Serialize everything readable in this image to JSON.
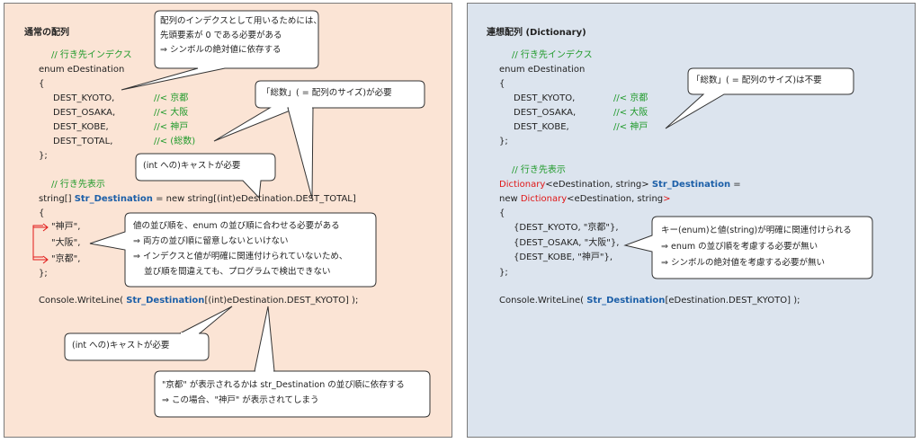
{
  "left": {
    "title": "通常の配列",
    "code": {
      "c1": "// 行き先インデクス",
      "enum": "enum eDestination",
      "ob": "{",
      "kyoto": "DEST_KYOTO,",
      "kyoto_c": "//< 京都",
      "osaka": "DEST_OSAKA,",
      "osaka_c": "//< 大阪",
      "kobe": "DEST_KOBE,",
      "kobe_c": "//< 神戸",
      "total": "DEST_TOTAL,",
      "total_c": "//< (総数)",
      "cb": "};",
      "c2": "// 行き先表示",
      "decl_a": "string[] ",
      "decl_b": "Str_Destination",
      "decl_c": " = new string[(int)eDestination.DEST_TOTAL]",
      "ob2": "{",
      "v1": "\"神戸\",",
      "v2": "\"大阪\",",
      "v3": "\"京都\",",
      "cb2": "};",
      "wl_a": "Console.WriteLine( ",
      "wl_b": "Str_Destination",
      "wl_c": "[(int)eDestination.DEST_KYOTO] );"
    },
    "callouts": {
      "c1": [
        "配列のインデクスとして用いるためには、",
        "先頭要素が 0 である必要がある",
        "⇒ シンボルの絶対値に依存する"
      ],
      "c2": "「総数」( = 配列のサイズ)が必要",
      "c3": "(int への)キャストが必要",
      "c4": [
        "値の並び順を、enum の並び順に合わせる必要がある",
        "⇒ 両方の並び順に留意しないといけない",
        "⇒ インデクスと値が明確に関連付けられていないため、",
        "    並び順を間違えても、プログラムで検出できない"
      ],
      "c5": "(int への)キャストが必要",
      "c6": [
        "\"京都\" が表示されるかは str_Destination の並び順に依存する",
        "⇒ この場合、\"神戸\" が表示されてしまう"
      ]
    }
  },
  "right": {
    "title": "連想配列 (Dictionary)",
    "code": {
      "c1": "// 行き先インデクス",
      "enum": "enum eDestination",
      "ob": "{",
      "kyoto": "DEST_KYOTO,",
      "kyoto_c": "//< 京都",
      "osaka": "DEST_OSAKA,",
      "osaka_c": "//< 大阪",
      "kobe": "DEST_KOBE,",
      "kobe_c": "//< 神戸",
      "cb": "};",
      "c2": "// 行き先表示",
      "decl1_a": "Dictionary",
      "decl1_b": "<eDestination, string> ",
      "decl1_c": "Str_Destination",
      "decl1_d": " =",
      "decl2_a": "new ",
      "decl2_b": "Dictionary",
      "decl2_c": "<eDestination, string",
      "decl2_d": ">",
      "ob2": "{",
      "e1": "{DEST_KYOTO, \"京都\"},",
      "e2": "{DEST_OSAKA, \"大阪\"},",
      "e3": "{DEST_KOBE, \"神戸\"},",
      "cb2": "};",
      "wl_a": "Console.WriteLine( ",
      "wl_b": "Str_Destination",
      "wl_c": "[eDestination.DEST_KYOTO] );"
    },
    "callouts": {
      "c1": "「総数」( = 配列のサイズ)は不要",
      "c2": [
        "キー(enum)と値(string)が明確に関連付けられる",
        "⇒ enum の並び順を考慮する必要が無い",
        "⇒ シンボルの絶対値を考慮する必要が無い"
      ]
    }
  }
}
